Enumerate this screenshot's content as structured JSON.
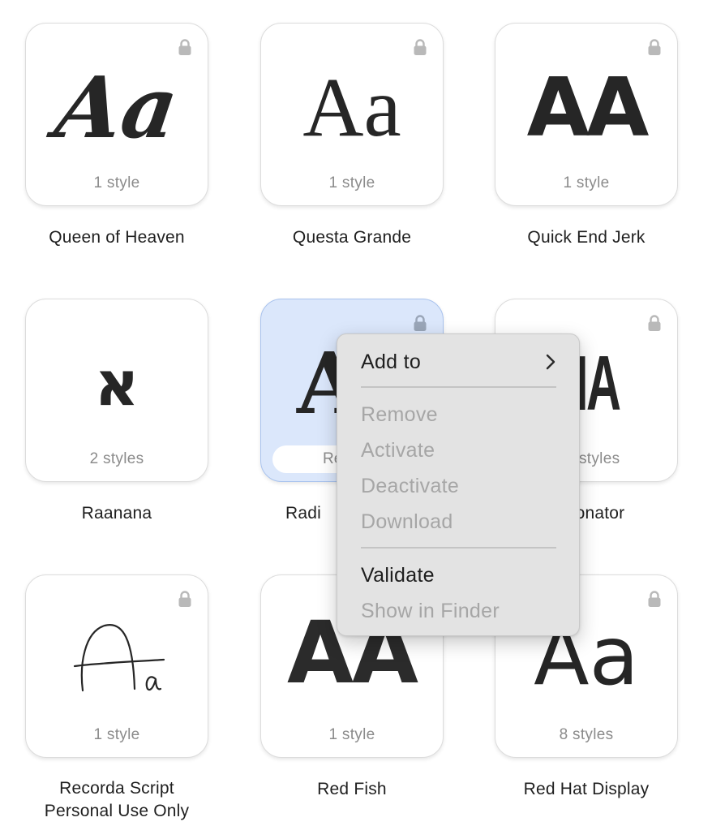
{
  "fonts": [
    {
      "name": "Queen of Heaven",
      "styles": "1 style",
      "preview": "Aa",
      "locked": true
    },
    {
      "name": "Questa Grande",
      "styles": "1 style",
      "preview": "Aa",
      "locked": true
    },
    {
      "name": "Quick End Jerk",
      "styles": "1 style",
      "preview": "AA",
      "locked": true
    },
    {
      "name": "Raanana",
      "styles": "2 styles",
      "preview": "א",
      "locked": false
    },
    {
      "name": "Radi",
      "styles": "Re",
      "preview": "A",
      "locked": true,
      "selected": true
    },
    {
      "name": "onator",
      "styles": "styles",
      "preview": "NA",
      "locked": true
    },
    {
      "name": "Recorda Script Personal Use Only",
      "styles": "1 style",
      "preview": "Aa",
      "locked": true
    },
    {
      "name": "Red Fish",
      "styles": "1 style",
      "preview": "AA",
      "locked": false
    },
    {
      "name": "Red Hat Display",
      "styles": "8 styles",
      "preview": "Aa",
      "locked": true
    }
  ],
  "context_menu": {
    "add_to": "Add to",
    "remove": "Remove",
    "activate": "Activate",
    "deactivate": "Deactivate",
    "download": "Download",
    "validate": "Validate",
    "show_in_finder": "Show in Finder"
  },
  "colors": {
    "selection_fill": "#dbe7fb",
    "selection_border": "#a9c3ee",
    "menu_background": "#e3e3e3",
    "disabled_text": "#a6a6a6"
  },
  "icons": {
    "lock": "lock-icon",
    "submenu": "chevron-right-icon"
  }
}
